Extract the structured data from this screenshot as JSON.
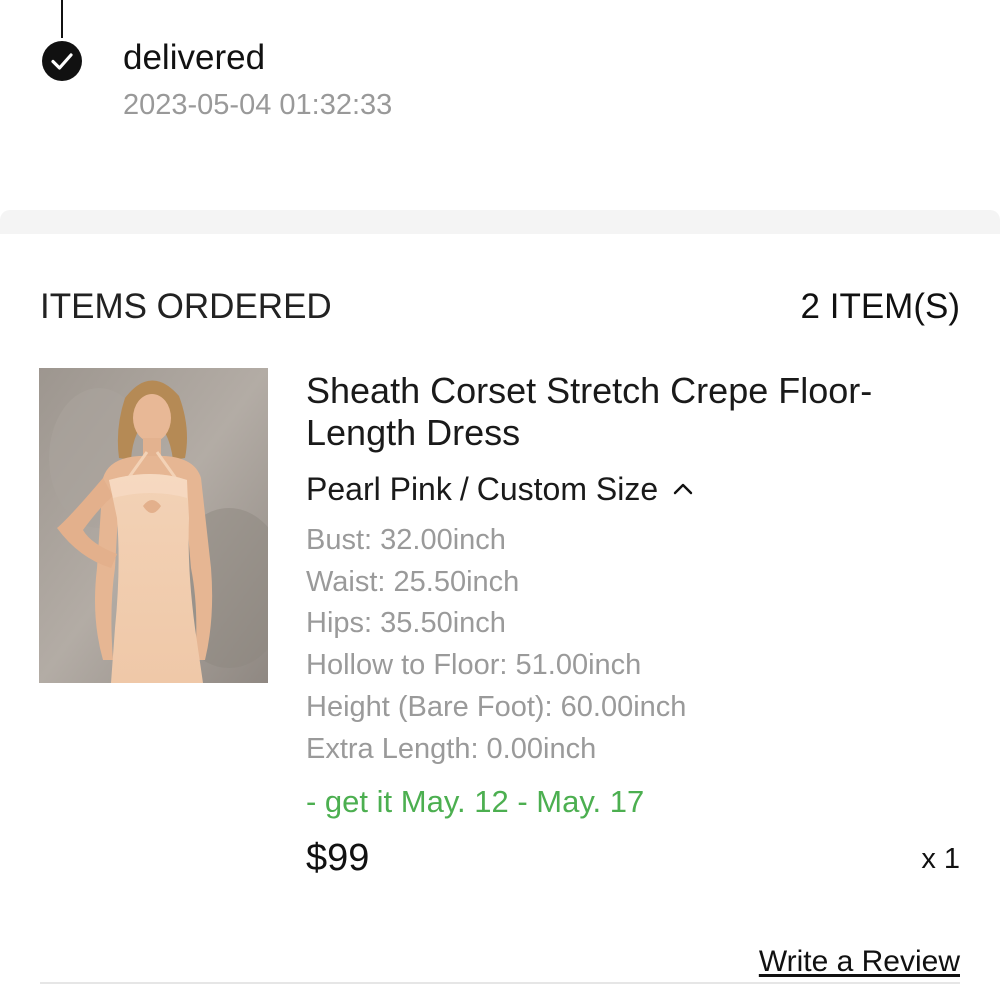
{
  "status": {
    "label": "delivered",
    "timestamp": "2023-05-04 01:32:33",
    "icon": "check-circle-icon"
  },
  "items_section": {
    "header": "ITEMS ORDERED",
    "count": "2 ITEM(S)"
  },
  "product": {
    "title": "Sheath Corset Stretch Crepe Floor-Length Dress",
    "color": "Pearl Pink",
    "separator": "/",
    "size_type": "Custom Size",
    "expand_icon": "chevron-up-icon",
    "measurements": [
      "Bust: 32.00inch",
      "Waist: 25.50inch",
      "Hips: 35.50inch",
      "Hollow to Floor: 51.00inch",
      "Height (Bare Foot): 60.00inch",
      "Extra Length: 0.00inch"
    ],
    "delivery_estimate": "- get it May. 12 - May. 17",
    "price": "$99",
    "quantity": "x 1",
    "review_link": "Write a Review"
  },
  "colors": {
    "delivery_green": "#4caf50",
    "muted_gray": "#999999",
    "band_gray": "#f4f4f4"
  }
}
